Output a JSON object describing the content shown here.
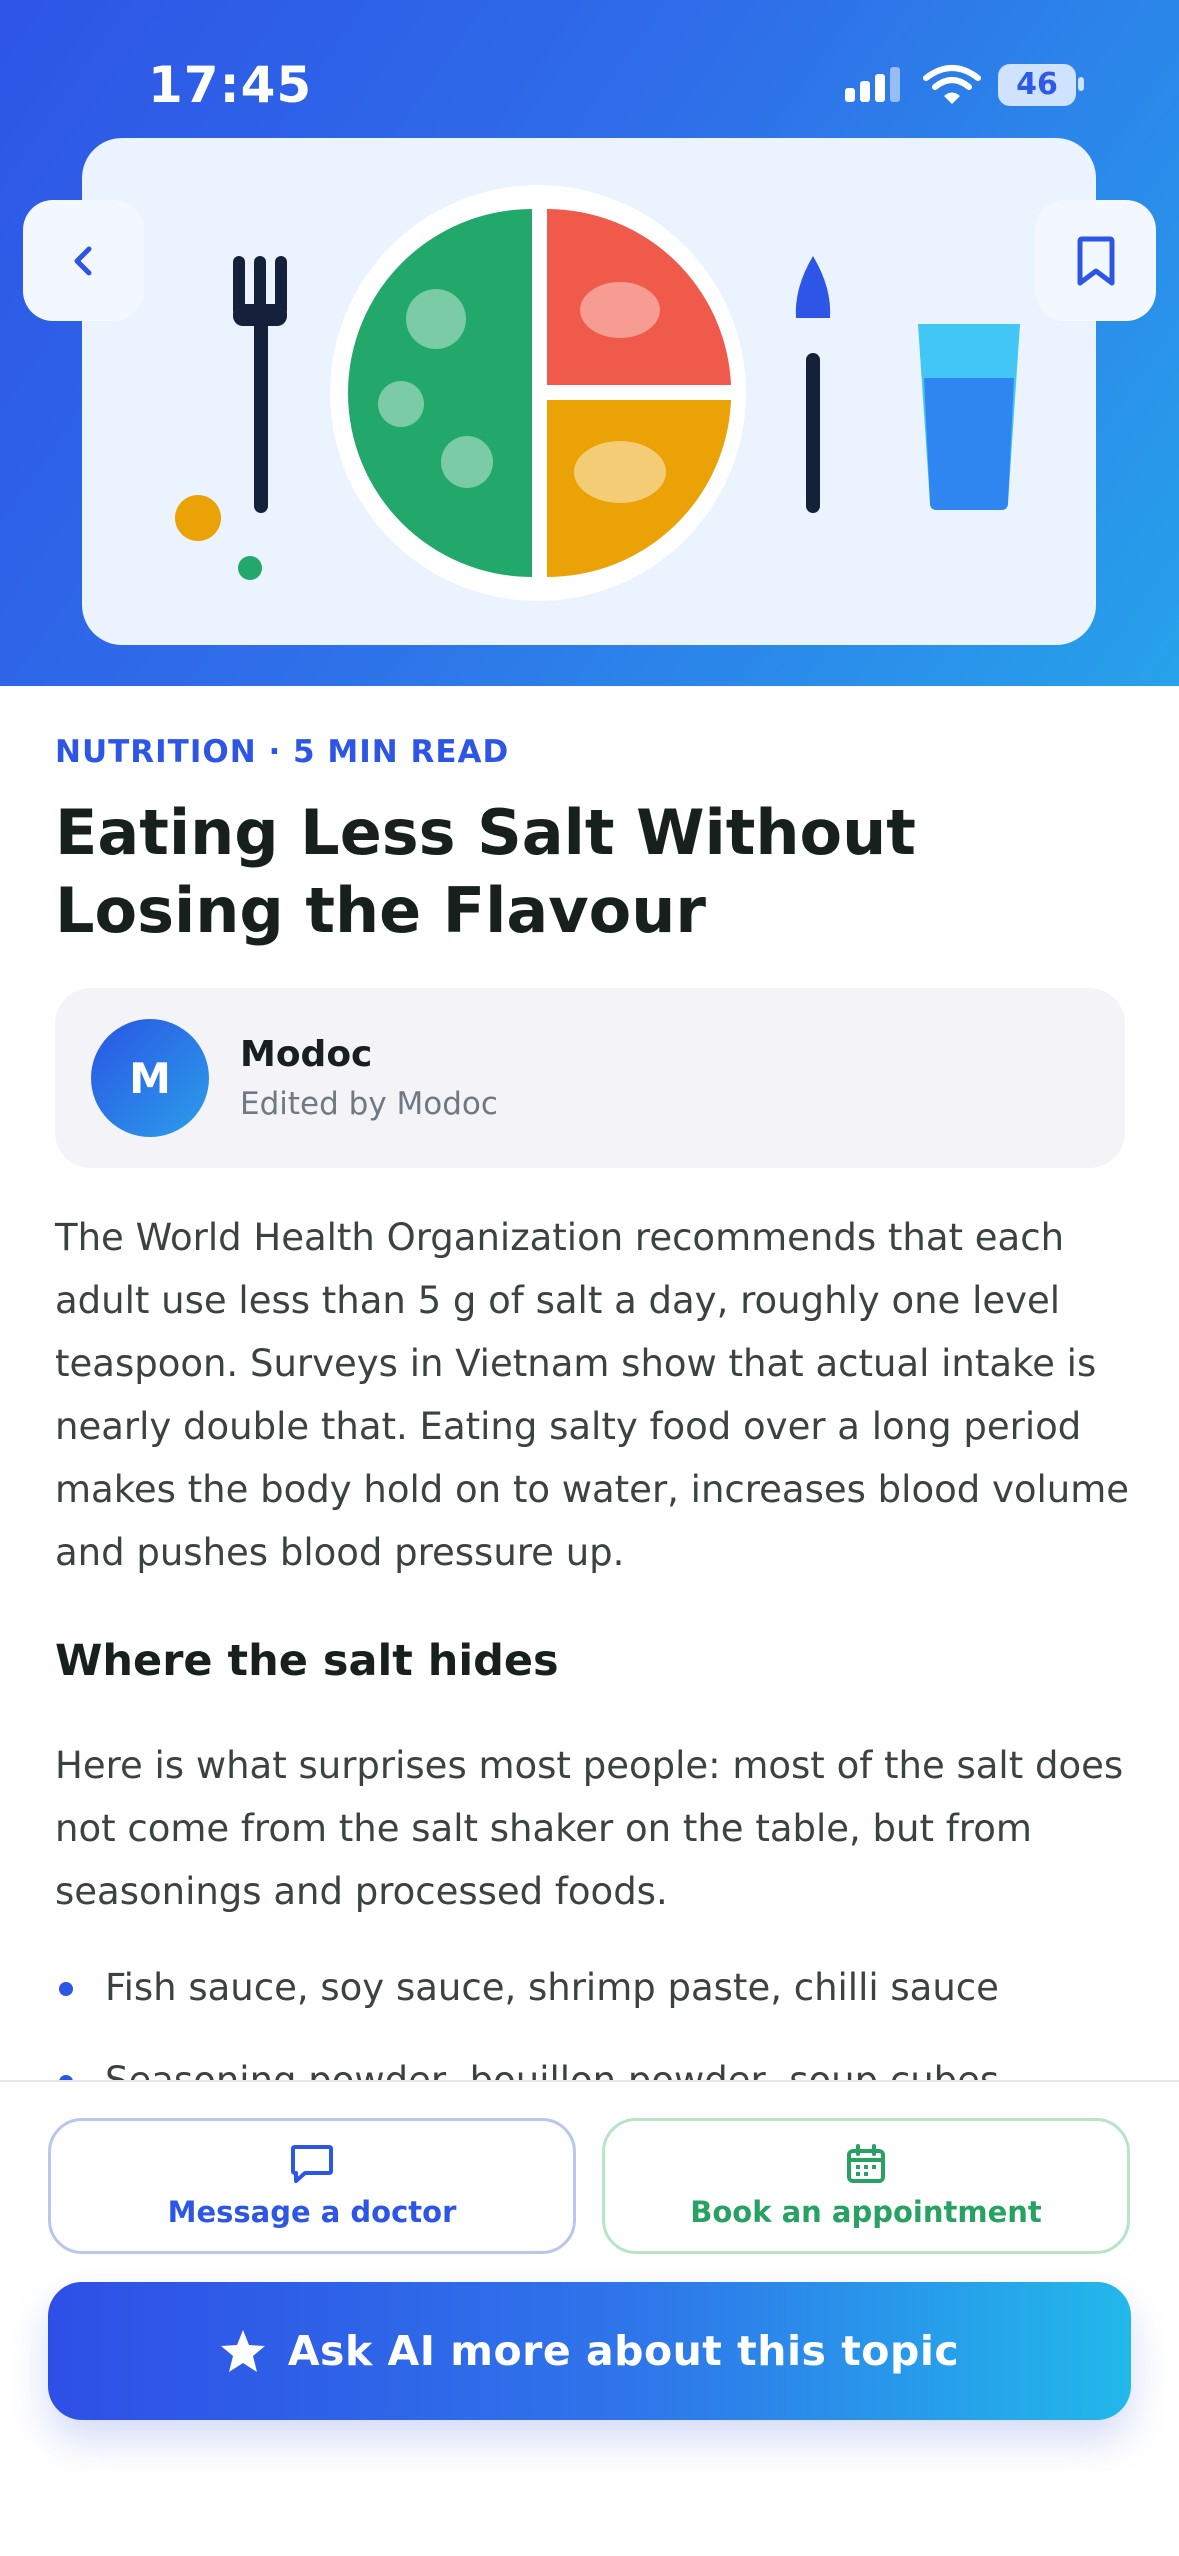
{
  "status_bar": {
    "time": "17:45",
    "battery": "46"
  },
  "header": {
    "back_icon": "chevron-left-icon",
    "bookmark_icon": "bookmark-icon",
    "illustration": "healthy-plate-illustration"
  },
  "article": {
    "eyebrow": "NUTRITION · 5 MIN READ",
    "title": "Eating Less Salt Without Losing the Flavour",
    "author": {
      "initial": "M",
      "name": "Modoc",
      "subtitle": "Edited by Modoc"
    },
    "intro": "The World Health Organization recommends that each adult use less than 5 g of salt a day, roughly one level teaspoon. Surveys in Vietnam show that actual intake is nearly double that. Eating salty food over a long period makes the body hold on to water, increases blood volume and pushes blood pressure up.",
    "section_heading": "Where the salt hides",
    "section_body": "Here is what surprises most people: most of the salt does not come from the salt shaker on the table, but from seasonings and processed foods.",
    "bullets": [
      "Fish sauce, soy sauce, shrimp paste, chilli sauce",
      "Seasoning powder, bouillon powder, soup cubes"
    ]
  },
  "actions": {
    "message_label": "Message a doctor",
    "message_icon": "chat-bubble-icon",
    "book_label": "Book an appointment",
    "book_icon": "calendar-icon",
    "ai_label": "Ask AI more about this topic",
    "ai_icon": "star-icon"
  },
  "colors": {
    "brand_blue": "#2d55e6",
    "brand_cyan": "#22b8ea",
    "success_green": "#28a262",
    "plate_green": "#22a86b",
    "plate_red": "#f05a4a",
    "plate_orange": "#eba206"
  }
}
